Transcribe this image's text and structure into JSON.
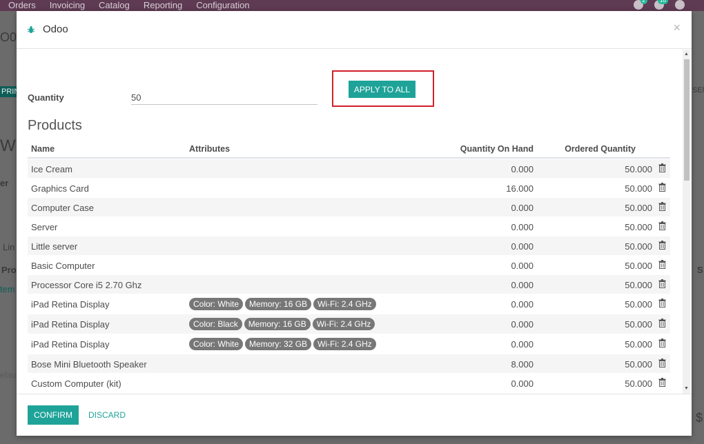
{
  "navbar": {
    "menu": [
      "Orders",
      "Invoicing",
      "Catalog",
      "Reporting",
      "Configuration"
    ],
    "activity_count": "2",
    "messages_count": "10"
  },
  "background": {
    "frag_1": "O0",
    "frag_2": "PRIN",
    "frag_3": "W",
    "frag_4": "er",
    "frag_5": "Lin",
    "frag_6": "Pro",
    "frag_7": "tem",
    "frag_8": "efau",
    "frag_9": "SEN",
    "frag_10": "S",
    "frag_11": "$"
  },
  "modal": {
    "title": "Odoo",
    "close": "×",
    "quantity_label": "Quantity",
    "quantity_value": "50",
    "apply_label": "APPLY TO ALL",
    "section_title": "Products",
    "columns": {
      "name": "Name",
      "attributes": "Attributes",
      "on_hand": "Quantity On Hand",
      "ordered": "Ordered Quantity"
    },
    "rows": [
      {
        "name": "Ice Cream",
        "attrs": [],
        "on_hand": "0.000",
        "ordered": "50.000"
      },
      {
        "name": "Graphics Card",
        "attrs": [],
        "on_hand": "16.000",
        "ordered": "50.000"
      },
      {
        "name": "Computer Case",
        "attrs": [],
        "on_hand": "0.000",
        "ordered": "50.000"
      },
      {
        "name": "Server",
        "attrs": [],
        "on_hand": "0.000",
        "ordered": "50.000"
      },
      {
        "name": "Little server",
        "attrs": [],
        "on_hand": "0.000",
        "ordered": "50.000"
      },
      {
        "name": "Basic Computer",
        "attrs": [],
        "on_hand": "0.000",
        "ordered": "50.000"
      },
      {
        "name": "Processor Core i5 2.70 Ghz",
        "attrs": [],
        "on_hand": "0.000",
        "ordered": "50.000"
      },
      {
        "name": "iPad Retina Display",
        "attrs": [
          "Color: White",
          "Memory: 16 GB",
          "Wi-Fi: 2.4 GHz"
        ],
        "on_hand": "0.000",
        "ordered": "50.000"
      },
      {
        "name": "iPad Retina Display",
        "attrs": [
          "Color: Black",
          "Memory: 16 GB",
          "Wi-Fi: 2.4 GHz"
        ],
        "on_hand": "0.000",
        "ordered": "50.000"
      },
      {
        "name": "iPad Retina Display",
        "attrs": [
          "Color: White",
          "Memory: 32 GB",
          "Wi-Fi: 2.4 GHz"
        ],
        "on_hand": "0.000",
        "ordered": "50.000"
      },
      {
        "name": "Bose Mini Bluetooth Speaker",
        "attrs": [],
        "on_hand": "8.000",
        "ordered": "50.000"
      },
      {
        "name": "Custom Computer (kit)",
        "attrs": [],
        "on_hand": "0.000",
        "ordered": "50.000"
      }
    ],
    "confirm_label": "CONFIRM",
    "discard_label": "DISCARD"
  },
  "colors": {
    "navbar": "#5e3a53",
    "primary": "#1fa399",
    "highlight": "#d22027",
    "tag": "#777777"
  }
}
